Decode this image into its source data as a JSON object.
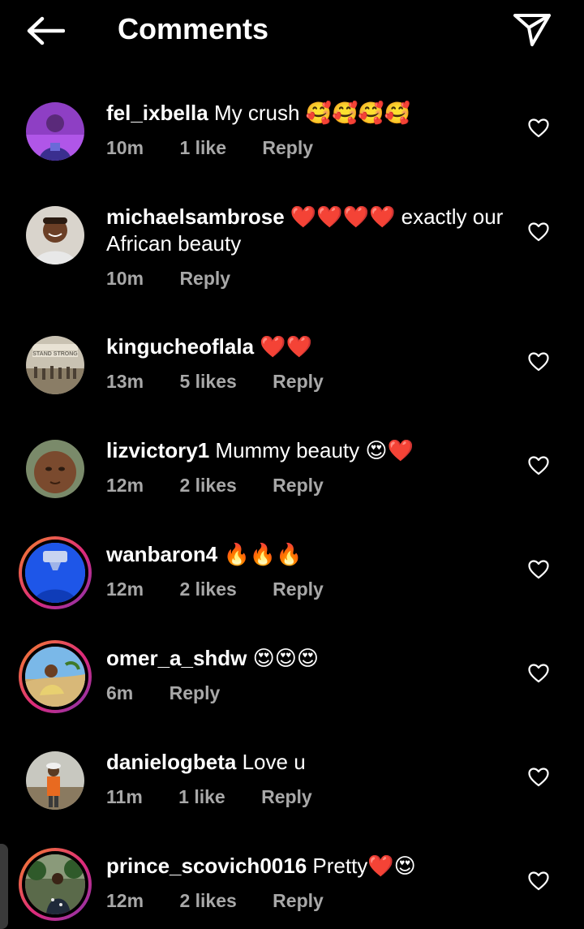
{
  "header": {
    "title": "Comments",
    "back_icon": "arrow-left-icon",
    "share_icon": "paper-plane-icon"
  },
  "comments": [
    {
      "user": "fel_ixbella",
      "text": "My crush 🥰🥰🥰🥰",
      "time": "10m",
      "likes": "1 like",
      "reply": "Reply",
      "avatar_ring": false
    },
    {
      "user": "michaelsambrose",
      "text": "❤️❤️❤️❤️ exactly our African beauty",
      "time": "10m",
      "likes": "",
      "reply": "Reply",
      "avatar_ring": false
    },
    {
      "user": "kingucheoflala",
      "text": "❤️❤️",
      "time": "13m",
      "likes": "5 likes",
      "reply": "Reply",
      "avatar_ring": false,
      "avatar_text": "STAND STRONG"
    },
    {
      "user": "lizvictory1",
      "text": "Mummy beauty 😍❤️",
      "time": "12m",
      "likes": "2 likes",
      "reply": "Reply",
      "avatar_ring": false
    },
    {
      "user": "wanbaron4",
      "text": "🔥🔥🔥",
      "time": "12m",
      "likes": "2 likes",
      "reply": "Reply",
      "avatar_ring": true
    },
    {
      "user": "omer_a_shdw",
      "text": "😍😍😍",
      "time": "6m",
      "likes": "",
      "reply": "Reply",
      "avatar_ring": true
    },
    {
      "user": "danielogbeta",
      "text": "Love u",
      "time": "11m",
      "likes": "1 like",
      "reply": "Reply",
      "avatar_ring": false
    },
    {
      "user": "prince_scovich0016",
      "text": "Pretty❤️😍",
      "time": "12m",
      "likes": "2 likes",
      "reply": "Reply",
      "avatar_ring": true
    }
  ],
  "colors": {
    "background": "#000000",
    "text": "#ffffff",
    "meta": "#a8a8a8",
    "ring_start": "#f58529",
    "ring_end": "#8134af"
  },
  "icons": {
    "like": "heart-outline-icon"
  }
}
